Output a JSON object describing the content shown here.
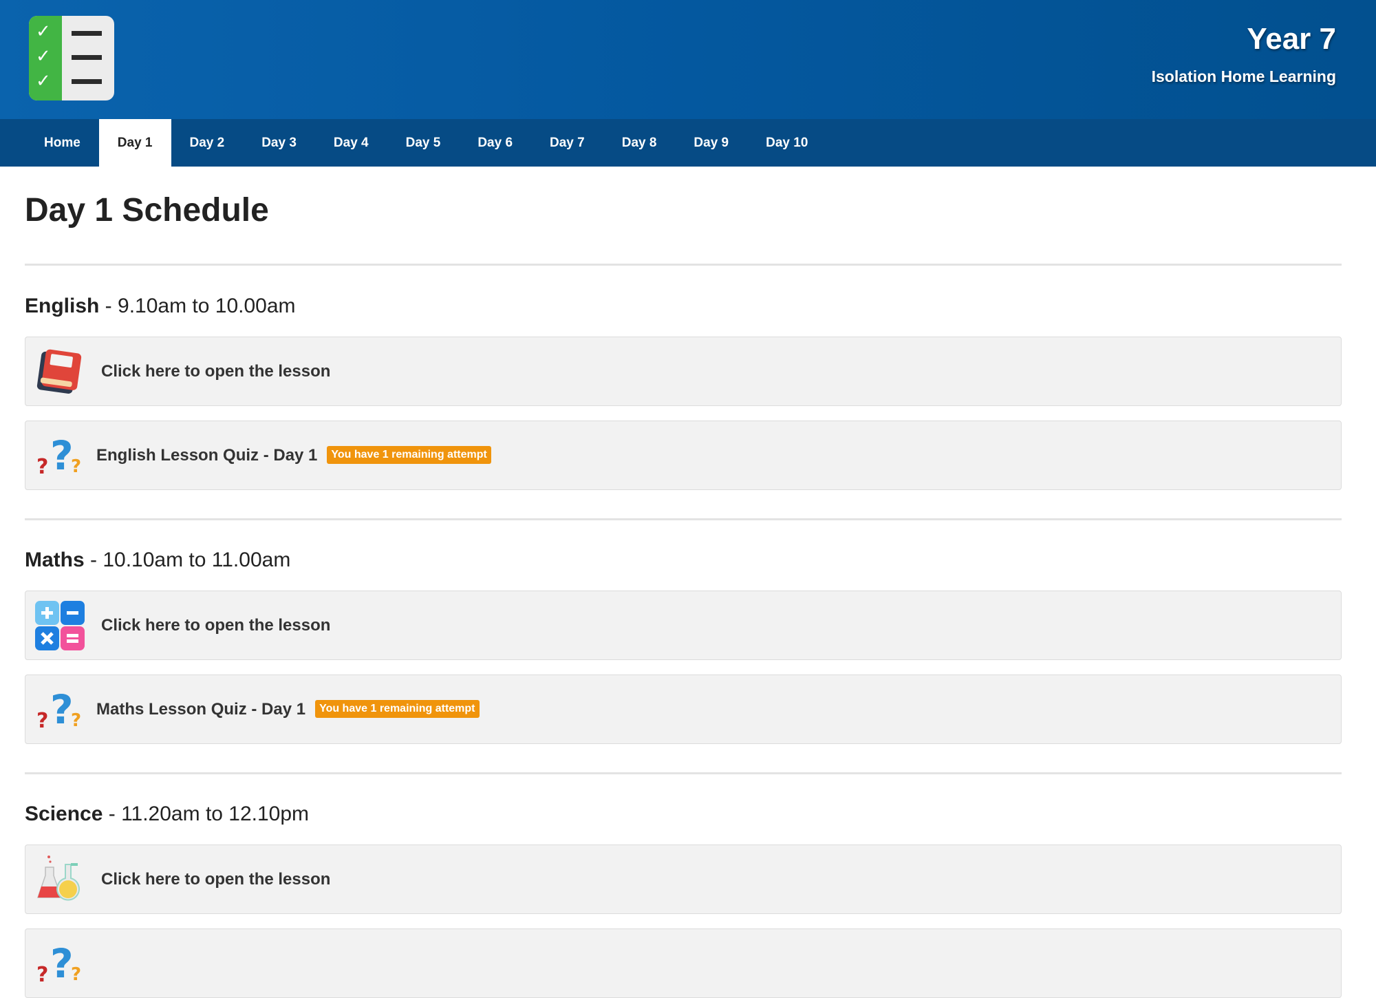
{
  "header": {
    "title": "Year 7",
    "subtitle": "Isolation Home Learning",
    "logo_icon": "checklist-icon"
  },
  "nav": {
    "items": [
      "Home",
      "Day 1",
      "Day 2",
      "Day 3",
      "Day 4",
      "Day 5",
      "Day 6",
      "Day 7",
      "Day 8",
      "Day 9",
      "Day 10"
    ],
    "active": "Day 1"
  },
  "page": {
    "heading": "Day 1 Schedule"
  },
  "sections": [
    {
      "subject": "English",
      "time": " - 9.10am to 10.00am",
      "lesson_label": "Click here to open the lesson",
      "lesson_icon": "book-icon",
      "quiz_label": "English Lesson Quiz - Day 1",
      "quiz_badge": "You have 1 remaining attempt",
      "quiz_icon": "question-marks-icon"
    },
    {
      "subject": "Maths",
      "time": " - 10.10am to 11.00am",
      "lesson_label": "Click here to open the lesson",
      "lesson_icon": "calculator-icon",
      "quiz_label": "Maths Lesson Quiz - Day 1",
      "quiz_badge": "You have 1 remaining attempt",
      "quiz_icon": "question-marks-icon"
    },
    {
      "subject": "Science",
      "time": " - 11.20am to 12.10pm",
      "lesson_label": "Click here to open the lesson",
      "lesson_icon": "flasks-icon",
      "quiz_label": "",
      "quiz_badge": "",
      "quiz_icon": "question-marks-icon"
    }
  ],
  "colors": {
    "header_blue": "#0a63ad",
    "nav_blue": "#064b85",
    "badge_orange": "#f0940c",
    "row_bg": "#f2f2f2"
  }
}
